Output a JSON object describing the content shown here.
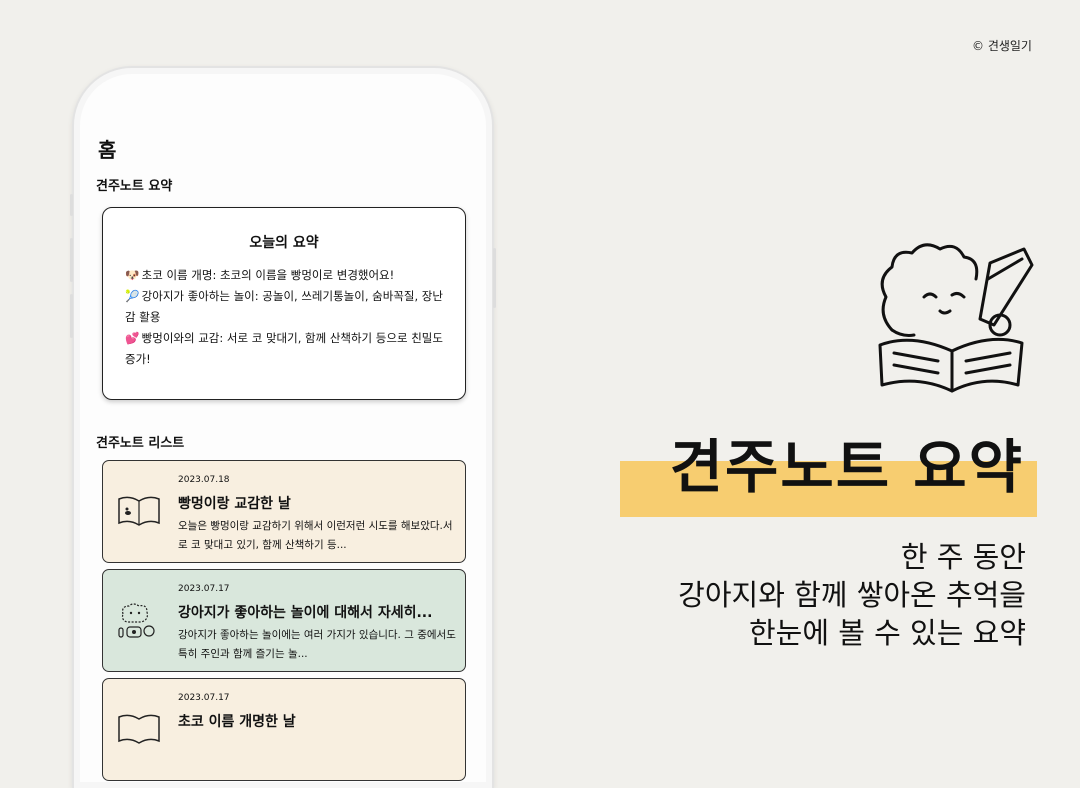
{
  "copyright": "© 견생일기",
  "app": {
    "screen_title": "홈",
    "summary_section_label": "견주노트 요약",
    "summary_card": {
      "title": "오늘의 요약",
      "items": [
        {
          "emoji": "🐶",
          "text": "초코 이름 개명: 초코의 이름을 빵멍이로 변경했어요!"
        },
        {
          "emoji": "🎾",
          "text": "강아지가 좋아하는 놀이: 공놀이, 쓰레기통놀이, 숨바꼭질, 장난감 활용"
        },
        {
          "emoji": "💕",
          "text": "빵멍이와의 교감: 서로 코 맞대기, 함께 산책하기 등으로 친밀도 증가!"
        }
      ]
    },
    "list_section_label": "견주노트 리스트",
    "notes": [
      {
        "date": "2023.07.18",
        "title": "빵멍이랑 교감한 날",
        "body": "오늘은 빵멍이랑 교감하기 위해서 이런저런 시도를 해보았다.서로 코 맞대고 있기, 함께 산책하기 등...",
        "icon": "book-dog-icon"
      },
      {
        "date": "2023.07.17",
        "title": "강아지가 좋아하는 놀이에 대해서 자세히...",
        "body": "강아지가 좋아하는 놀이에는 여러 가지가 있습니다. 그 중에서도 특히 주인과 함께 즐기는 놀...",
        "icon": "dog-toys-icon"
      },
      {
        "date": "2023.07.17",
        "title": "초코 이름 개명한 날",
        "body": "",
        "icon": "book-icon"
      }
    ]
  },
  "promo": {
    "heading": "견주노트 요약",
    "tagline": [
      "한 주 동안",
      "강아지와 함께 쌓아온 추억을",
      "한눈에 볼 수 있는 요약"
    ]
  },
  "colors": {
    "background": "#f1f0ec",
    "highlight": "#f7cd70",
    "card_beige": "#f8efe0",
    "card_green": "#d9e7dc"
  }
}
